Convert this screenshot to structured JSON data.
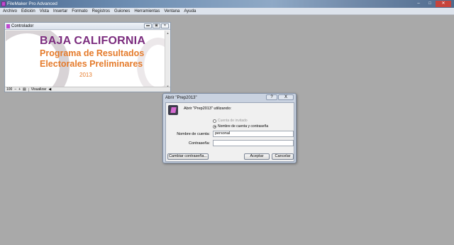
{
  "window": {
    "title": "FileMaker Pro Advanced",
    "min": "–",
    "max": "□",
    "close": "✕"
  },
  "menu": [
    "Archivo",
    "Edición",
    "Vista",
    "Insertar",
    "Formato",
    "Registros",
    "Guiones",
    "Herramientas",
    "Ventana",
    "Ayuda"
  ],
  "controller": {
    "title": "Controlador",
    "banner": {
      "line1": "BAJA CALIFORNIA",
      "line2": "Programa de Resultados",
      "line3": "Electorales Preliminares",
      "year": "2013"
    },
    "status": {
      "zoom": "100",
      "zoom_out": "–",
      "zoom_in": "+",
      "mode": "Visualizar"
    }
  },
  "dialog": {
    "title": "Abrir \"Prep2013\"",
    "help": "?",
    "close": "X",
    "heading": "Abrir \"Prep2013\" utilizando:",
    "radio_guest": "Cuenta de invitado",
    "radio_account": "Nombre de cuenta y contraseña",
    "account_label": "Nombre de cuenta:",
    "account_value": "personal",
    "password_label": "Contraseña:",
    "password_value": "",
    "change_password": "Cambiar contraseña...",
    "ok": "Aceptar",
    "cancel": "Cancelar"
  },
  "colors": {
    "banner_purple": "#7b2c7e",
    "banner_orange": "#e57b2b",
    "workspace": "#a9a9a9"
  }
}
